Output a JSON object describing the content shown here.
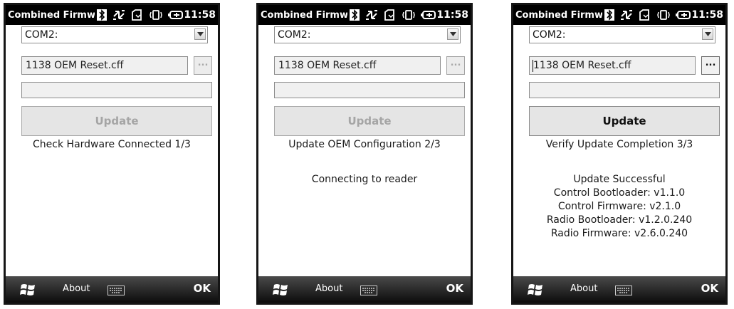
{
  "screens": [
    {
      "title": "Combined Firmwa",
      "time": "11:58",
      "port": "COM2:",
      "file_name": "1138 OEM Reset.cff",
      "browse_label": "...",
      "update_label": "Update",
      "status_text": "Check Hardware Connected 1/3",
      "message_lines": [],
      "bottom_about": "About",
      "bottom_ok": "OK"
    },
    {
      "title": "Combined Firmwa",
      "time": "11:58",
      "port": "COM2:",
      "file_name": "1138 OEM Reset.cff",
      "browse_label": "...",
      "update_label": "Update",
      "status_text": "Update OEM Configuration 2/3",
      "message_lines": [
        "Connecting to reader"
      ],
      "bottom_about": "About",
      "bottom_ok": "OK"
    },
    {
      "title": "Combined Firmwa",
      "time": "11:58",
      "port": "COM2:",
      "file_name": "1138 OEM Reset.cff",
      "browse_label": "...",
      "update_label": "Update",
      "status_text": "Verify Update Completion 3/3",
      "message_lines": [
        "Update Successful",
        "Control Bootloader: v1.1.0",
        "Control Firmware: v2.1.0",
        "Radio Bootloader: v1.2.0.240",
        "Radio Firmware: v2.6.0.240"
      ],
      "bottom_about": "About",
      "bottom_ok": "OK"
    }
  ],
  "icons": [
    "bluetooth-icon",
    "sync-icon",
    "signal-icon",
    "vibrate-icon",
    "battery-icon",
    "dropdown-arrow-icon",
    "windows-start-icon",
    "keyboard-icon"
  ]
}
